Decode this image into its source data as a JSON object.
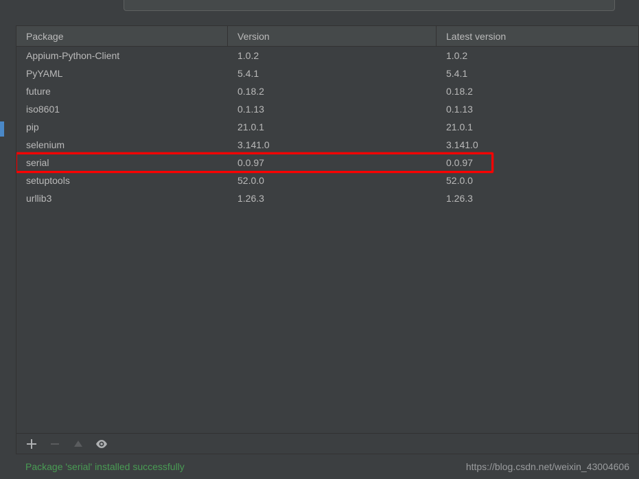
{
  "columns": {
    "package": "Package",
    "version": "Version",
    "latest": "Latest version"
  },
  "packages": [
    {
      "name": "Appium-Python-Client",
      "version": "1.0.2",
      "latest": "1.0.2"
    },
    {
      "name": "PyYAML",
      "version": "5.4.1",
      "latest": "5.4.1"
    },
    {
      "name": "future",
      "version": "0.18.2",
      "latest": "0.18.2"
    },
    {
      "name": "iso8601",
      "version": "0.1.13",
      "latest": "0.1.13"
    },
    {
      "name": "pip",
      "version": "21.0.1",
      "latest": "21.0.1"
    },
    {
      "name": "selenium",
      "version": "3.141.0",
      "latest": "3.141.0"
    },
    {
      "name": "serial",
      "version": "0.0.97",
      "latest": "0.0.97"
    },
    {
      "name": "setuptools",
      "version": "52.0.0",
      "latest": "52.0.0"
    },
    {
      "name": "urllib3",
      "version": "1.26.3",
      "latest": "1.26.3"
    }
  ],
  "highlighted_index": 6,
  "status_message": "Package 'serial' installed successfully",
  "watermark": "https://blog.csdn.net/weixin_43004606",
  "toolbar": {
    "add": "+",
    "remove": "−",
    "upgrade": "▲",
    "show": "eye"
  }
}
